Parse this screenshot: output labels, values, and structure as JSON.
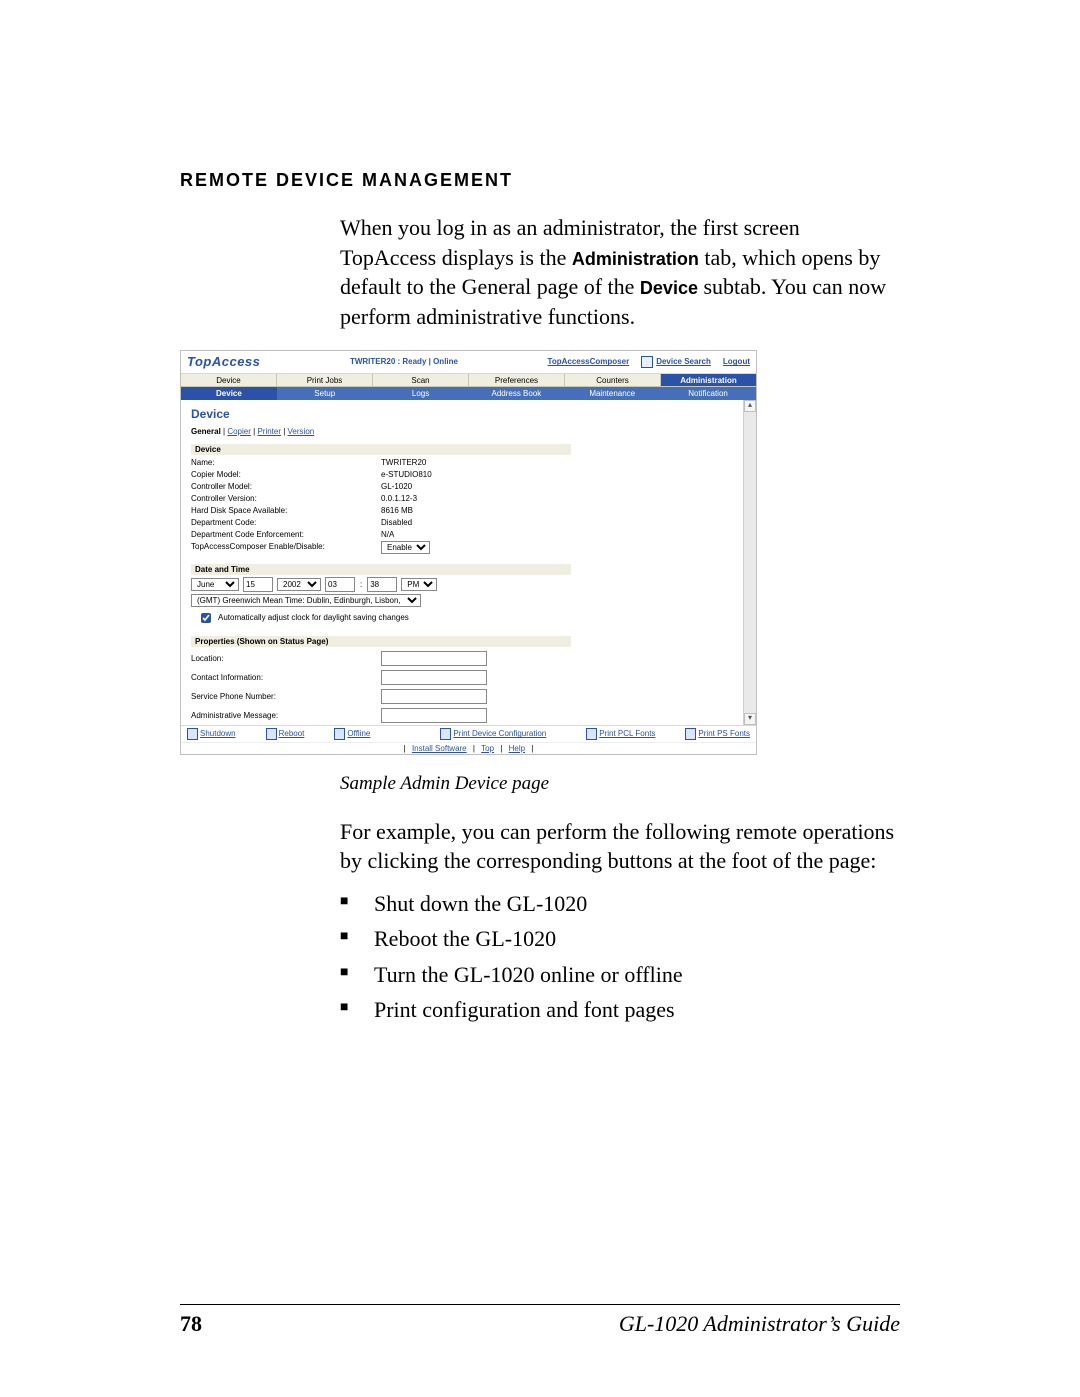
{
  "heading": "REMOTE DEVICE MANAGEMENT",
  "intro_pre": "When you log in as an administrator, the first screen TopAccess displays is the ",
  "intro_bold1": "Administration",
  "intro_mid": " tab, which opens by default to the General page of the ",
  "intro_bold2": "Device",
  "intro_post": " subtab. You can now perform administrative functions.",
  "caption": "Sample Admin Device page",
  "post_text": "For example, you can perform the following remote operations by clicking the corresponding buttons at the foot of the page:",
  "bullets": [
    "Shut down the GL-1020",
    "Reboot the GL-1020",
    "Turn the GL-1020 online or offline",
    "Print configuration and font pages"
  ],
  "footer": {
    "page": "78",
    "title": "GL-1020 Administrator’s Guide"
  },
  "shot": {
    "logo": "TopAccess",
    "status": "TWRITER20 : Ready | Online",
    "header_links": {
      "composer": "TopAccessComposer",
      "search": "Device Search",
      "logout": "Logout"
    },
    "tabs": [
      "Device",
      "Print Jobs",
      "Scan",
      "Preferences",
      "Counters",
      "Administration"
    ],
    "active_tab": "Administration",
    "subtabs": [
      "Device",
      "Setup",
      "Logs",
      "Address Book",
      "Maintenance",
      "Notification"
    ],
    "active_subtab": "Device",
    "body_title": "Device",
    "body_nav": [
      "General",
      "Copier",
      "Printer",
      "Version"
    ],
    "body_nav_active": "General",
    "sections": {
      "device": {
        "title": "Device",
        "rows": {
          "name_k": "Name:",
          "name_v": "TWRITER20",
          "copier_k": "Copier Model:",
          "copier_v": "e-STUDIO810",
          "ctrl_k": "Controller Model:",
          "ctrl_v": "GL-1020",
          "ver_k": "Controller Version:",
          "ver_v": "0.0.1.12-3",
          "hdd_k": "Hard Disk Space Available:",
          "hdd_v": "8616 MB",
          "dept_k": "Department Code:",
          "dept_v": "Disabled",
          "deptenf_k": "Department Code Enforcement:",
          "deptenf_v": "N/A",
          "tac_k": "TopAccessComposer Enable/Disable:",
          "tac_select": "Enable"
        }
      },
      "datetime": {
        "title": "Date and Time",
        "month": "June",
        "day": "15",
        "year": "2002",
        "hour": "03",
        "minute": "38",
        "ampm": "PM",
        "tz": "(GMT) Greenwich Mean Time: Dublin, Edinburgh, Lisbon, London",
        "auto_label": "Automatically adjust clock for daylight saving changes"
      },
      "props": {
        "title": "Properties (Shown on Status Page)",
        "location": "Location:",
        "contact": "Contact Information:",
        "phone": "Service Phone Number:",
        "admin": "Administrative Message:"
      }
    },
    "footer_links": {
      "shutdown": "Shutdown",
      "reboot": "Reboot",
      "offline": "Offline",
      "printcfg": "Print Device Configuration",
      "pclfonts": "Print PCL Fonts",
      "psfonts": "Print PS Fonts"
    },
    "footer2": {
      "install": "Install Software",
      "top": "Top",
      "help": "Help"
    }
  }
}
